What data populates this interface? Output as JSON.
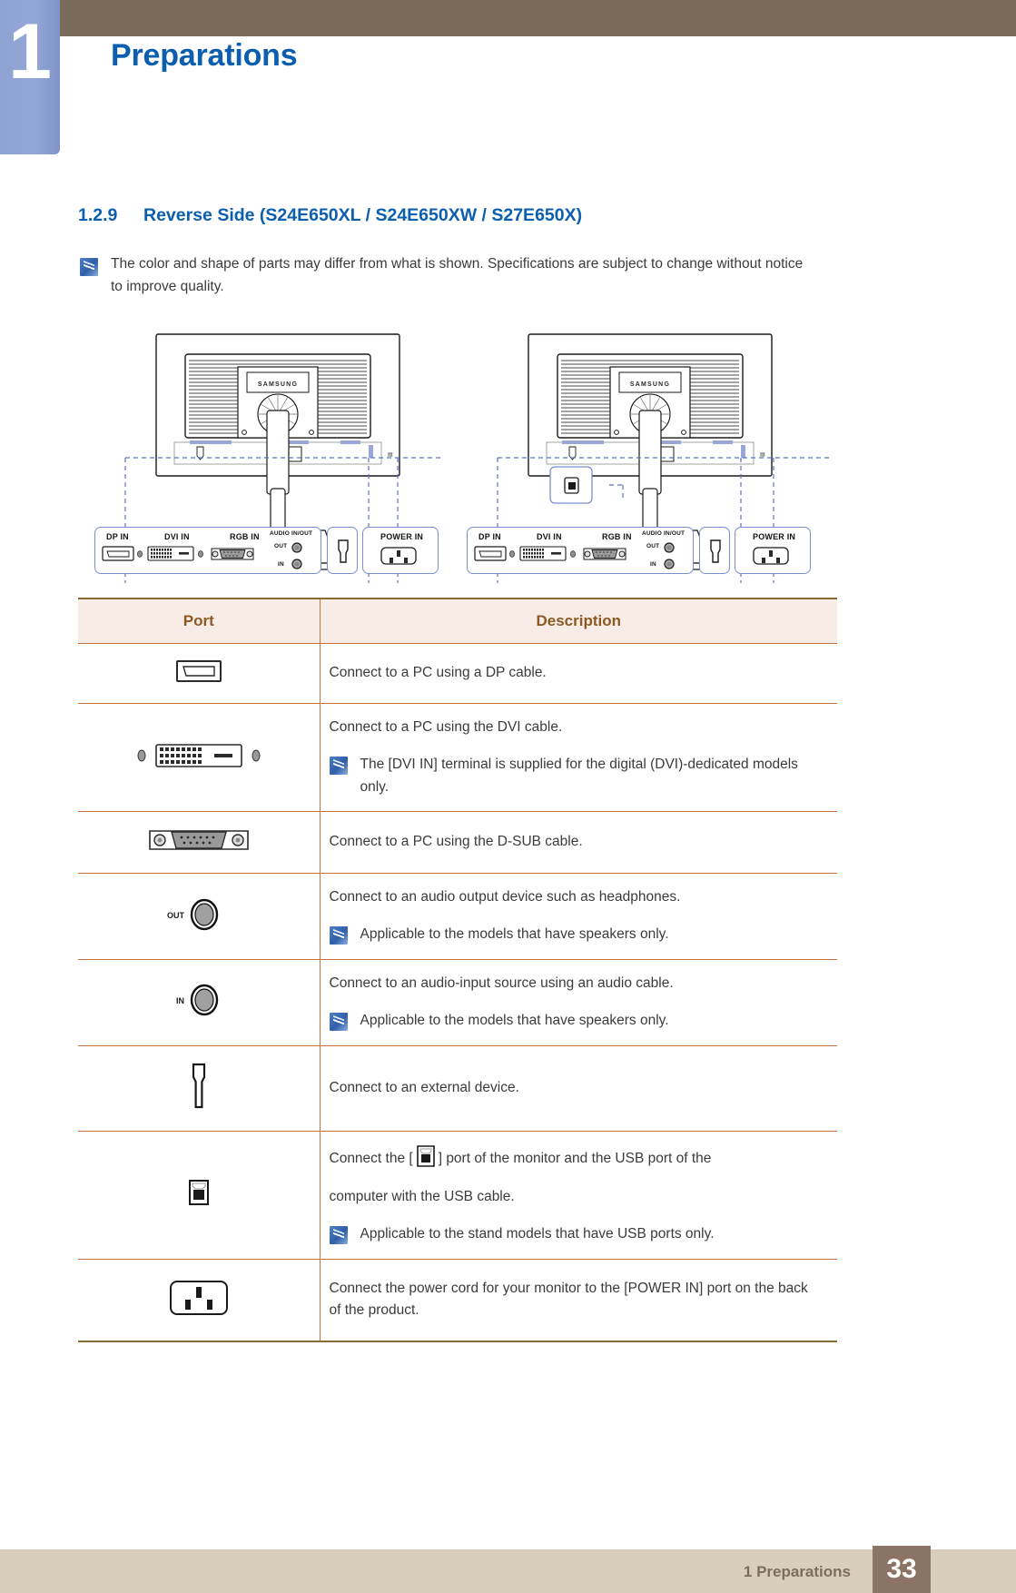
{
  "chapter": {
    "number": "1",
    "title": "Preparations"
  },
  "section": {
    "number": "1.2.9",
    "title": "Reverse Side (S24E650XL / S24E650XW / S27E650X)"
  },
  "top_note": {
    "icon": "note-icon",
    "text": "The color and shape of parts may differ from what is shown. Specifications are subject to change without notice to improve quality."
  },
  "diagrams": {
    "left": {
      "brand": "SAMSUNG",
      "port_labels": {
        "dp": "DP IN",
        "dvi": "DVI IN",
        "rgb": "RGB IN",
        "audio": "AUDIO IN/OUT",
        "audio_out": "OUT",
        "audio_in": "IN",
        "power": "POWER IN"
      }
    },
    "right": {
      "brand": "SAMSUNG",
      "port_labels": {
        "dp": "DP IN",
        "dvi": "DVI IN",
        "rgb": "RGB IN",
        "audio": "AUDIO IN/OUT",
        "audio_out": "OUT",
        "audio_in": "IN",
        "power": "POWER IN"
      }
    }
  },
  "table": {
    "headers": {
      "port": "Port",
      "description": "Description"
    },
    "rows": [
      {
        "icon": "displayport-icon",
        "description": "Connect to a PC using a DP cable.",
        "note": null
      },
      {
        "icon": "dvi-icon",
        "description": "Connect to a PC using the DVI cable.",
        "note": "The [DVI IN] terminal is supplied for the digital (DVI)-dedicated models only."
      },
      {
        "icon": "dsub-icon",
        "description": "Connect to a PC using the D-SUB cable.",
        "note": null
      },
      {
        "icon": "audio-out-icon",
        "icon_label": "OUT",
        "description": "Connect to an audio output device such as headphones.",
        "note": "Applicable to the models that have speakers only."
      },
      {
        "icon": "audio-in-icon",
        "icon_label": "IN",
        "description": "Connect to an audio-input source using an audio cable.",
        "note": "Applicable to the models that have speakers only."
      },
      {
        "icon": "external-device-icon",
        "description": "Connect to an external device.",
        "note": null
      },
      {
        "icon": "usb-upstream-icon",
        "description_part1": "Connect the [",
        "description_part2": "] port of the monitor and the USB port of the",
        "description_part3": "computer with the USB cable.",
        "note": "Applicable to the stand models that have USB ports only."
      },
      {
        "icon": "power-in-icon",
        "description": "Connect the power cord for your monitor to the [POWER IN] port on the back of the product.",
        "note": null
      }
    ]
  },
  "footer": {
    "label": "1 Preparations",
    "page": "33"
  },
  "colors": {
    "accent_blue": "#0b5fae",
    "header_band": "#796a5a",
    "tab_blue": "#8fa3d4",
    "table_border": "#c5723b",
    "table_header_bg": "#f7ece6",
    "table_header_text": "#8a5a22",
    "footer_band": "#d9cdbb",
    "footer_page_bg": "#8b7466"
  }
}
